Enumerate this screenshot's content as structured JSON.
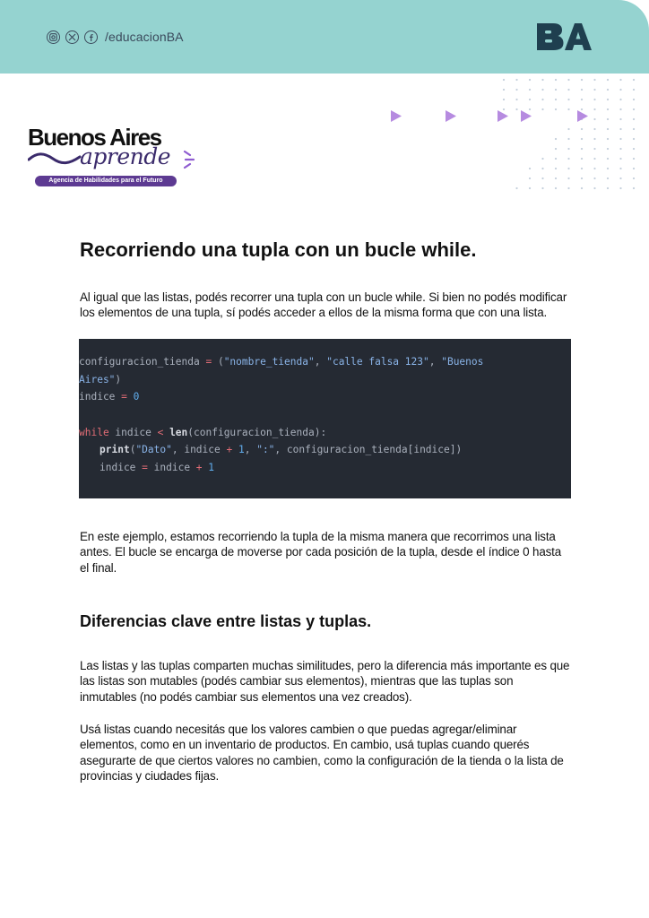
{
  "header": {
    "handle": "/educacionBA",
    "icons": [
      "instagram-icon",
      "x-icon",
      "facebook-icon"
    ],
    "logo_text": "BA",
    "background_color": "#95d3d0"
  },
  "brand": {
    "title": "Buenos Aires",
    "script": "aprende",
    "tagline": "Agencia de Habilidades para el Futuro",
    "accent_color": "#5d3a92"
  },
  "article": {
    "title": "Recorriendo una tupla con un bucle while.",
    "intro": "Al igual que las listas, podés recorrer una tupla con un bucle while. Si bien no podés modificar los elementos de una tupla, sí podés acceder a ellos de la misma forma que con una lista.",
    "explanation": "En este ejemplo, estamos recorriendo la tupla de la misma manera que recorrimos una lista antes. El bucle se encarga de moverse por cada posición de la tupla, desde el índice 0 hasta el final.",
    "section_title": "Diferencias clave entre listas y tuplas.",
    "paragraph1": "Las listas y las tuplas comparten muchas similitudes, pero la diferencia más importante es que las listas son mutables (podés cambiar sus elementos), mientras que las tuplas son inmutables (no podés cambiar sus elementos una vez creados).",
    "paragraph2": "Usá listas cuando necesitás que los valores cambien o que puedas agregar/eliminar elementos, como en un inventario de productos. En cambio, usá tuplas cuando querés asegurarte de que ciertos valores no cambien, como la configuración de la tienda o la lista de provincias y ciudades fijas."
  },
  "code": {
    "l1_var": "configuracion_tienda",
    "l1_eq": " = ",
    "l1_open": "(",
    "l1_s1": "\"nombre_tienda\"",
    "l1_c1": ", ",
    "l1_s2": "\"calle falsa 123\"",
    "l1_c2": ", ",
    "l1_s3a": "\"Buenos",
    "l2_s3b": "Aires\"",
    "l2_close": ")",
    "l3_var": "indice",
    "l3_eq": " = ",
    "l3_num": "0",
    "l5_kw": "while",
    "l5_a": " indice ",
    "l5_op": "<",
    "l5_fn": " len",
    "l5_b": "(configuracion_tienda):",
    "l6_fn": "print",
    "l6_a": "(",
    "l6_s1": "\"Dato\"",
    "l6_b": ", indice ",
    "l6_op": "+",
    "l6_num": " 1",
    "l6_c": ", ",
    "l6_s2": "\":\"",
    "l6_d": ", configuracion_tienda[indice])",
    "l7_a": "indice ",
    "l7_op": "=",
    "l7_b": " indice ",
    "l7_op2": "+",
    "l7_num": " 1"
  }
}
